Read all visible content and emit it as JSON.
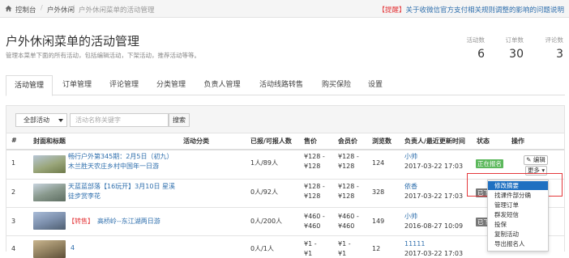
{
  "breadcrumb": {
    "items": [
      "控制台",
      "户外休闲",
      "户外休闲菜单的活动管理"
    ]
  },
  "notice": {
    "tag": "【提醒】",
    "text": "关于收微信官方支付相关规则调整的影响的问题说明"
  },
  "page": {
    "title": "户外休闲菜单的活动管理",
    "description": "管理本菜单下面的所有活动，包括编辑活动，下架活动，推荐活动等等。"
  },
  "stats": [
    {
      "label": "活动数",
      "value": "6"
    },
    {
      "label": "订单数",
      "value": "30"
    },
    {
      "label": "评论数",
      "value": "3"
    }
  ],
  "tabs": [
    {
      "label": "活动管理",
      "active": true
    },
    {
      "label": "订单管理"
    },
    {
      "label": "评论管理"
    },
    {
      "label": "分类管理"
    },
    {
      "label": "负责人管理"
    },
    {
      "label": "活动线路转售"
    },
    {
      "label": "购买保险"
    },
    {
      "label": "设置"
    }
  ],
  "filter": {
    "select_value": "全部活动",
    "search_placeholder": "活动名称关键字",
    "search_button": "搜索"
  },
  "table": {
    "headers": [
      "#",
      "封面和标题",
      "活动分类",
      "已报/可报人数",
      "售价",
      "会员价",
      "浏览数",
      "负责人/最近更新时间",
      "状态",
      "操作"
    ],
    "rows": [
      {
        "num": "1",
        "title1": "畅行户外第345期：2月5日（初九）",
        "title2": "木兰胜天农庄乡村中国年一日游",
        "sign": "1人/89人",
        "price1": "¥128 -",
        "price2": "¥128",
        "member1": "¥128 -",
        "member2": "¥128",
        "views": "124",
        "owner": "小帅",
        "time": "2017-03-22 17:03",
        "status": "正在报名",
        "thumb": "#8a9a6a"
      },
      {
        "num": "2",
        "title1": "天蓝蓝部落【16玩开】3月10日 星溪",
        "title2": "徒步赏李花",
        "sign": "0人/92人",
        "price1": "¥128 -",
        "price2": "¥128",
        "member1": "¥128 -",
        "member2": "¥128",
        "views": "328",
        "owner": "依香",
        "time": "2017-03-22 17:03",
        "status": "已下架",
        "thumb": "#7b8d8e"
      },
      {
        "num": "3",
        "tag": "【转售】",
        "title1": "高桥岭--东江湖两日游",
        "title2": "",
        "sign": "0人/200人",
        "price1": "¥460 -",
        "price2": "¥460",
        "member1": "¥460 -",
        "member2": "¥460",
        "views": "149",
        "owner": "小帅",
        "time": "2016-08-27 10:09",
        "status": "已下架",
        "thumb": "#6d7f9a"
      },
      {
        "num": "4",
        "title1": "4",
        "title2": "",
        "sign": "0人/1人",
        "price1": "¥1 -",
        "price2": "¥1",
        "member1": "¥1 -",
        "member2": "¥1",
        "views": "12",
        "owner": "11111",
        "time": "2017-03-22 17:03",
        "status": "",
        "thumb": "#8a7a5a"
      }
    ],
    "edit_label": "编辑",
    "more_label": "更多"
  },
  "menu": {
    "items": [
      "修改摘要",
      "找课件部分确",
      "管理订单",
      "群发短信",
      "投保",
      "复制活动",
      "导出报名人"
    ]
  },
  "colors": {
    "link": "#2f6fad",
    "active_status": "#5cb85c",
    "off_status": "#777777",
    "menu_highlight": "#1f70c1",
    "alert": "#e4393c"
  }
}
